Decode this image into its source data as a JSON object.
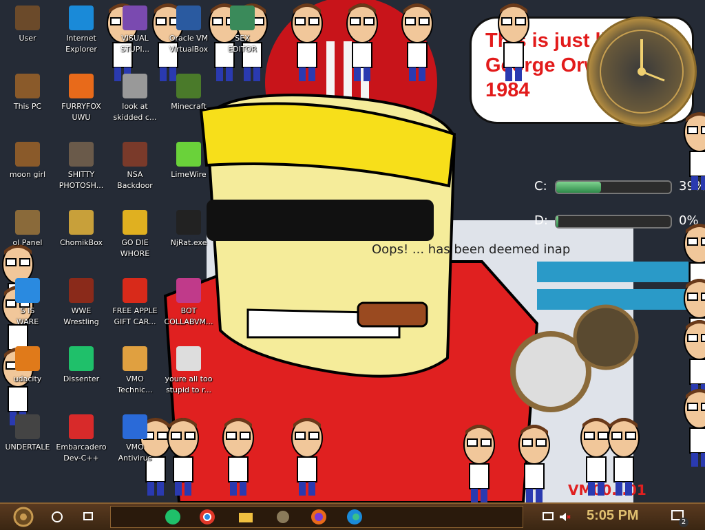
{
  "desktop_icons": [
    {
      "label": "User",
      "icon": "user-folder-icon",
      "color": "#6b4a2a"
    },
    {
      "label": "Internet\nExplorer",
      "icon": "edge-icon",
      "color": "#1a8ad8"
    },
    {
      "label": "VISUAL\nSTUPI...",
      "icon": "visual-studio-icon",
      "color": "#7a4ab0"
    },
    {
      "label": "Oracle VM\nVirtualBox",
      "icon": "virtualbox-icon",
      "color": "#2a5aa0"
    },
    {
      "label": "SEX\nEDITOR",
      "icon": "hex-editor-icon",
      "color": "#3a8a5a"
    },
    {
      "label": "This PC",
      "icon": "computer-icon",
      "color": "#8a5a2a"
    },
    {
      "label": "FURRYFOX\nUWU",
      "icon": "firefox-icon",
      "color": "#e86a1a"
    },
    {
      "label": "look at\nskidded c...",
      "icon": "copy-icon",
      "color": "#999999"
    },
    {
      "label": "Minecraft",
      "icon": "minecraft-icon",
      "color": "#4a7a2a"
    },
    {
      "label": "moon girl",
      "icon": "folder-icon",
      "color": "#8a5a2a"
    },
    {
      "label": "SHITTY\nPHOTOSH...",
      "icon": "gimp-icon",
      "color": "#6a5a4a"
    },
    {
      "label": "NSA\nBackdoor",
      "icon": "frame-icon",
      "color": "#7a3a2a"
    },
    {
      "label": "LimeWire",
      "icon": "limewire-icon",
      "color": "#6ad23a"
    },
    {
      "label": "ol Panel",
      "icon": "control-panel-icon",
      "color": "#8a6a3a"
    },
    {
      "label": "ChomikBox",
      "icon": "chomikbox-icon",
      "color": "#c8a03a"
    },
    {
      "label": "GO DIE\nWHORE",
      "icon": "de-icon",
      "color": "#e0b020"
    },
    {
      "label": "NjRat.exe",
      "icon": "skull-icon",
      "color": "#222222"
    },
    {
      "label": "S IS\nWARE",
      "icon": "chrome-icon",
      "color": "#2a8ae0"
    },
    {
      "label": "WWE\nWrestling",
      "icon": "wrestling-icon",
      "color": "#8a2a1a"
    },
    {
      "label": "FREE APPLE\nGIFT CAR...",
      "icon": "apple-icon",
      "color": "#d82a1a"
    },
    {
      "label": "BOT\nCOLLABVM...",
      "icon": "monitor-icon",
      "color": "#c03a8a"
    },
    {
      "label": "udacity",
      "icon": "audacity-icon",
      "color": "#e07a1a"
    },
    {
      "label": "Dissenter",
      "icon": "dissenter-icon",
      "color": "#1fc06a"
    },
    {
      "label": "VMO\nTechnic...",
      "icon": "technician-icon",
      "color": "#e0a040"
    },
    {
      "label": "youre all too\nstupid to r...",
      "icon": "portrait-icon",
      "color": "#dddddd"
    },
    {
      "label": "UNDERTALE",
      "icon": "unity-icon",
      "color": "#444444"
    },
    {
      "label": "Embarcadero\nDev-C++",
      "icon": "devcpp-icon",
      "color": "#d82a2a"
    },
    {
      "label": "VMO\nAntivirus",
      "icon": "shield-icon",
      "color": "#2a6ad8"
    }
  ],
  "wallpaper": {
    "speech_text": "This is just like\nGeorge Orwell's\n1984",
    "background_text": "Oops! ... has been deemed inap",
    "watermark": "VM00...01"
  },
  "drives": [
    {
      "letter": "C:",
      "percent": 39,
      "percent_label": "39%"
    },
    {
      "letter": "D:",
      "percent": 0,
      "percent_label": "0%"
    }
  ],
  "taskbar": {
    "pinned": [
      "start-button",
      "cortana-button",
      "task-view-button",
      "dissenter-pinned",
      "chrome-pinned",
      "explorer-pinned",
      "gimp-pinned",
      "firefox-pinned",
      "edge-pinned"
    ],
    "time": "5:05 PM",
    "notification_count": "2"
  },
  "colors": {
    "speech_red": "#e21b1b",
    "taskbar_brown": "#4a2f18"
  }
}
